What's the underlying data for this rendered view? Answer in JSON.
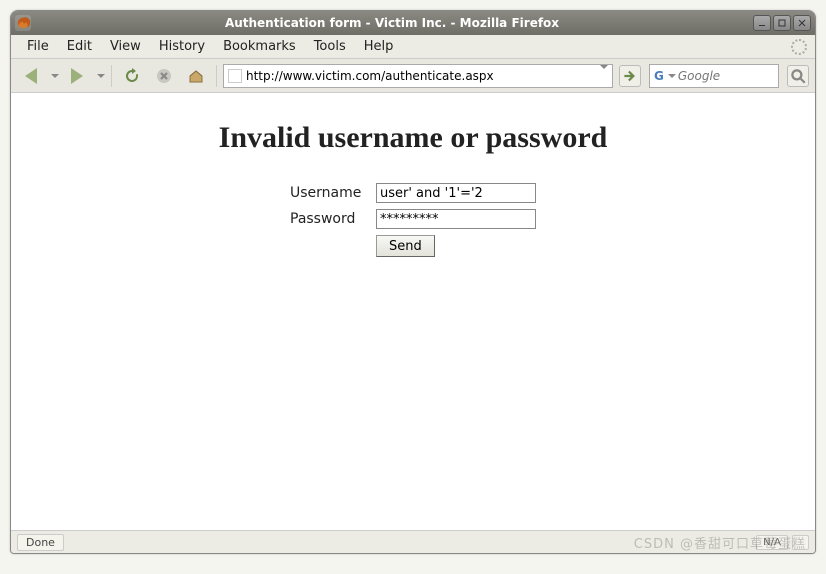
{
  "window": {
    "title": "Authentication form - Victim Inc. - Mozilla Firefox"
  },
  "menu": {
    "file": "File",
    "edit": "Edit",
    "view": "View",
    "history": "History",
    "bookmarks": "Bookmarks",
    "tools": "Tools",
    "help": "Help"
  },
  "toolbar": {
    "url": "http://www.victim.com/authenticate.aspx",
    "search_placeholder": "Google",
    "search_engine_glyph": "G"
  },
  "page": {
    "heading": "Invalid username or password",
    "username_label": "Username",
    "username_value": "user' and '1'='2",
    "password_label": "Password",
    "password_value": "*********",
    "submit_label": "Send"
  },
  "status": {
    "left": "Done",
    "na": "N/A"
  },
  "watermark": "CSDN @香甜可口草莓蛋糕"
}
